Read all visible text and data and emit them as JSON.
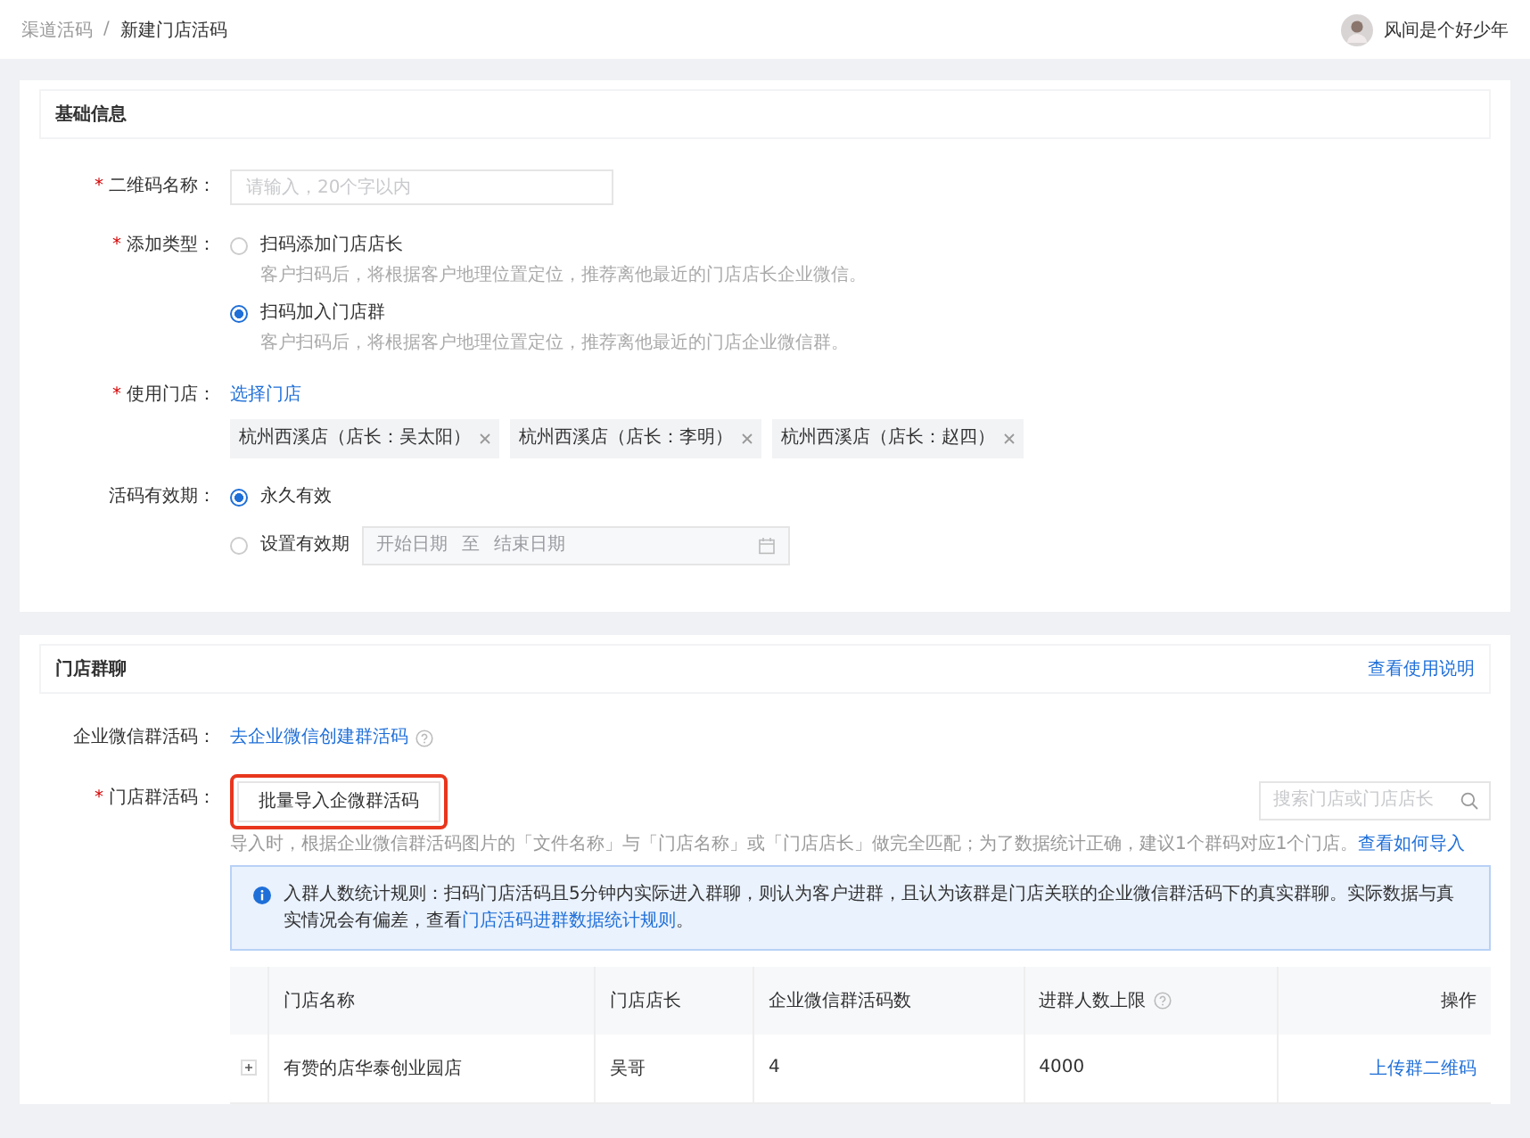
{
  "breadcrumb": [
    {
      "label": "渠道活码",
      "current": false
    },
    {
      "label": "新建门店活码",
      "current": true
    }
  ],
  "breadcrumb_separator": "/",
  "user": {
    "name": "风间是个好少年"
  },
  "basic_info": {
    "title": "基础信息",
    "qr_name": {
      "label": "二维码名称：",
      "required_mark": "*",
      "placeholder": "请输入，20个字以内"
    },
    "add_type": {
      "label": "添加类型：",
      "required_mark": "*",
      "options": [
        {
          "label": "扫码添加门店店长",
          "hint": "客户扫码后，将根据客户地理位置定位，推荐离他最近的门店店长企业微信。",
          "selected": false
        },
        {
          "label": "扫码加入门店群",
          "hint": "客户扫码后，将根据客户地理位置定位，推荐离他最近的门店企业微信群。",
          "selected": true
        }
      ]
    },
    "stores": {
      "label": "使用门店：",
      "required_mark": "*",
      "link": "选择门店",
      "tags": [
        {
          "label": "杭州西溪店（店长：吴太阳）"
        },
        {
          "label": "杭州西溪店（店长：李明）"
        },
        {
          "label": "杭州西溪店（店长：赵四）"
        }
      ]
    },
    "validity": {
      "label": "活码有效期：",
      "options": [
        {
          "label": "永久有效",
          "selected": true
        },
        {
          "label": "设置有效期",
          "selected": false
        }
      ],
      "start_placeholder": "开始日期",
      "range_separator": "至",
      "end_placeholder": "结束日期"
    }
  },
  "store_groups": {
    "title": "门店群聊",
    "help_link": "查看使用说明",
    "wecom_code": {
      "label": "企业微信群活码：",
      "link": "去企业微信创建群活码"
    },
    "group_code": {
      "label": "门店群活码：",
      "required_mark": "*",
      "button": "批量导入企微群活码",
      "highlighted": true
    },
    "search": {
      "placeholder": "搜索门店或门店店长"
    },
    "import_hint": "导入时，根据企业微信群活码图片的「文件名称」与「门店名称」或「门店店长」做完全匹配；为了数据统计正确，建议1个群码对应1个门店。",
    "import_link": "查看如何导入",
    "notice": {
      "text": "入群人数统计规则：扫码门店活码且5分钟内实际进入群聊，则认为客户进群，且认为该群是门店关联的企业微信群活码下的真实群聊。实际数据与真实情况会有偏差，查看",
      "link": "门店活码进群数据统计规则",
      "end": "。"
    },
    "table": {
      "columns": [
        {
          "label": "门店名称",
          "help": false
        },
        {
          "label": "门店店长",
          "help": false
        },
        {
          "label": "企业微信群活码数",
          "help": false
        },
        {
          "label": "进群人数上限",
          "help": true
        },
        {
          "label": "操作",
          "help": false
        }
      ],
      "rows": [
        {
          "expanded": false,
          "cells": [
            "有赞的店华泰创业园店",
            "吴哥",
            "4",
            "4000"
          ],
          "action": "上传群二维码"
        }
      ]
    }
  }
}
